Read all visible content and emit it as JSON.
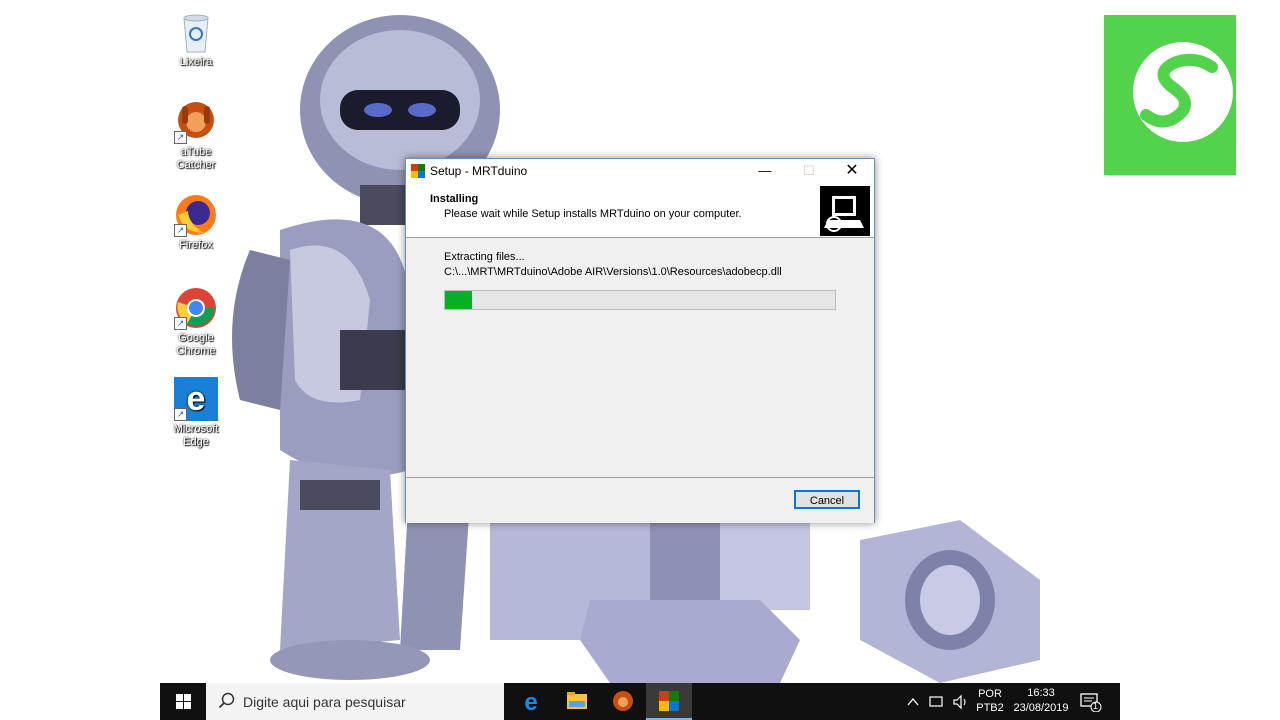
{
  "desktop": {
    "icons": [
      {
        "label": "Lixeira",
        "icon": "recycle-bin-icon"
      },
      {
        "label": "aTube Catcher",
        "icon": "atube-catcher-icon"
      },
      {
        "label": "Firefox",
        "icon": "firefox-icon"
      },
      {
        "label": "Google Chrome",
        "icon": "chrome-icon"
      },
      {
        "label": "Microsoft Edge",
        "icon": "edge-icon"
      }
    ]
  },
  "window": {
    "title": "Setup - MRTduino",
    "controls": {
      "minimize": "—",
      "maximize": "☐",
      "close": "✕"
    },
    "header_title": "Installing",
    "header_subtitle": "Please wait while Setup installs MRTduino on your computer.",
    "status": "Extracting files...",
    "file_path": "C:\\...\\MRT\\MRTduino\\Adobe AIR\\Versions\\1.0\\Resources\\adobecp.dll",
    "progress": 0.07,
    "cancel_label": "Cancel"
  },
  "taskbar": {
    "search_placeholder": "Digite aqui para pesquisar",
    "apps": [
      "edge-icon",
      "file-explorer-icon",
      "atube-catcher-icon",
      "mrtduino-setup-icon"
    ],
    "language_line1": "POR",
    "language_line2": "PTB2",
    "time": "16:33",
    "date": "23/08/2019",
    "notification_count": "1"
  },
  "colors": {
    "accent": "#0078d7",
    "progress": "#06b025",
    "logo": "#53d34c",
    "taskbar": "#101010"
  }
}
